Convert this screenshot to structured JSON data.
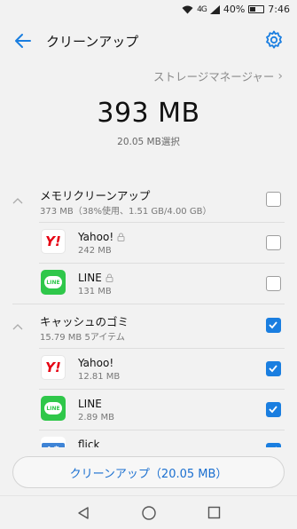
{
  "status": {
    "battery": "40%",
    "time": "7:46",
    "network": "4G"
  },
  "appbar": {
    "title": "クリーンアップ"
  },
  "storage_link": "ストレージマネージャー",
  "summary": {
    "total": "393 MB",
    "selected": "20.05 MB選択"
  },
  "groups": [
    {
      "title": "メモリクリーンアップ",
      "subtitle": "373 MB（38%使用、1.51 GB/4.00 GB）",
      "checked": false,
      "items": [
        {
          "name": "Yahoo!",
          "size": "242 MB",
          "icon": "yahoo-icon",
          "locked": true,
          "checked": false
        },
        {
          "name": "LINE",
          "size": "131 MB",
          "icon": "line-icon",
          "locked": true,
          "checked": false
        }
      ]
    },
    {
      "title": "キャッシュのゴミ",
      "subtitle": "15.79 MB  5アイテム",
      "checked": true,
      "items": [
        {
          "name": "Yahoo!",
          "size": "12.81 MB",
          "icon": "yahoo-icon",
          "locked": false,
          "checked": true
        },
        {
          "name": "LINE",
          "size": "2.89 MB",
          "icon": "line-icon",
          "locked": false,
          "checked": true
        },
        {
          "name": "flick",
          "size": "",
          "icon": "flick-icon",
          "locked": false,
          "checked": true
        }
      ]
    }
  ],
  "icon_text": {
    "yahoo": "Y!",
    "line": "LINE",
    "flick": "A あ"
  },
  "clean_button": "クリーンアップ（20.05 MB）",
  "colors": {
    "accent": "#1a7ee0",
    "line_green": "#2fc74a",
    "yahoo_red": "#e60012"
  }
}
